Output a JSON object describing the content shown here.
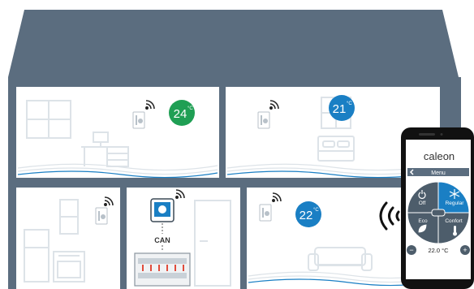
{
  "rooms": {
    "study": {
      "temperature": "24",
      "unit": "°C",
      "badge_color": "#1f9f54"
    },
    "bedroom": {
      "temperature": "21",
      "unit": "°C",
      "badge_color": "#1a7fc4"
    },
    "living": {
      "temperature": "22",
      "unit": "°C",
      "badge_color": "#1a7fc4"
    }
  },
  "hallway": {
    "bus_label": "CAN"
  },
  "phone": {
    "brand": "caleon",
    "menu_label": "Menu",
    "modes": {
      "off": "Off",
      "regular": "Regular",
      "eco": "Eco",
      "confort": "Confort"
    },
    "setpoint": "22.0 °C",
    "minus": "−",
    "plus": "+"
  },
  "colors": {
    "house_frame": "#5b6d7f",
    "roof": "#5b6d7f",
    "room_bg": "#ffffff",
    "line_art": "#dde3e8",
    "wave_accent": "#1a7fc4",
    "selected_mode": "#1a7fc4",
    "unselected_mode": "#4d5d6b"
  },
  "icons": [
    "thermostat-icon",
    "wifi-icon",
    "radio-waves-icon",
    "power-icon",
    "snowflake-icon",
    "leaf-icon",
    "thermometer-icon",
    "back-arrow-icon"
  ]
}
